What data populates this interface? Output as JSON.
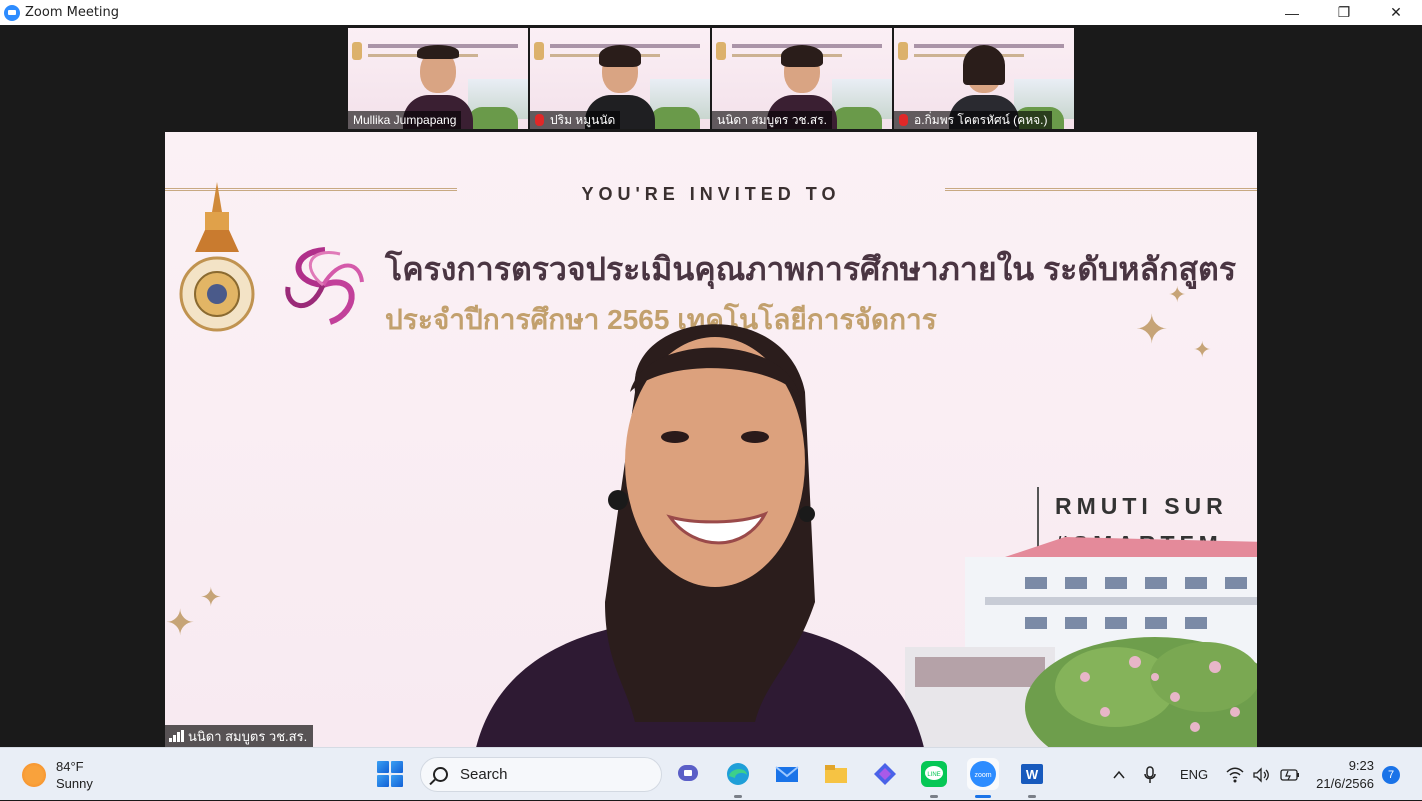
{
  "window": {
    "title": "Zoom Meeting",
    "minimize_glyph": "—",
    "restore_glyph": "❐",
    "close_glyph": "✕"
  },
  "participants": [
    {
      "name": "Mullika Jumpapang",
      "muted": false,
      "active_speaker": true
    },
    {
      "name": "ปริม  หมูนนัด",
      "muted": true,
      "active_speaker": false
    },
    {
      "name": "นนิดา สมบูตร วช.สร.",
      "muted": false,
      "active_speaker": false
    },
    {
      "name": "อ.กิ่มพร โคตรหัศน์ (คหจ.)",
      "muted": true,
      "active_speaker": false
    }
  ],
  "main_view": {
    "speaker_name": "นนิดา สมบูตร วช.สร.",
    "slide": {
      "invited": "YOU'RE INVITED TO",
      "title_th": "โครงการตรวจประเมินคุณภาพการศึกษาภายใน ระดับหลักสูตร",
      "subtitle_th": "ประจำปีการศึกษา 2565 เทคโนโลยีการจัดการ",
      "tagline_1": "RMUTI SUR",
      "tagline_2": "#SMARTFM"
    }
  },
  "taskbar": {
    "weather_temp": "84°F",
    "weather_desc": "Sunny",
    "search_label": "Search",
    "apps": [
      "teams-chat",
      "edge",
      "mail",
      "file-explorer",
      "copilot",
      "line",
      "zoom",
      "word"
    ],
    "language": "ENG",
    "time": "9:23",
    "date": "21/6/2566",
    "notification_count": "7"
  },
  "colors": {
    "slide_bg": "#fbf1f5",
    "title_color": "#4a3542",
    "gold": "#c2a06d",
    "active_speaker_border": "#9acd32",
    "taskbar_bg": "#e9eef6"
  }
}
